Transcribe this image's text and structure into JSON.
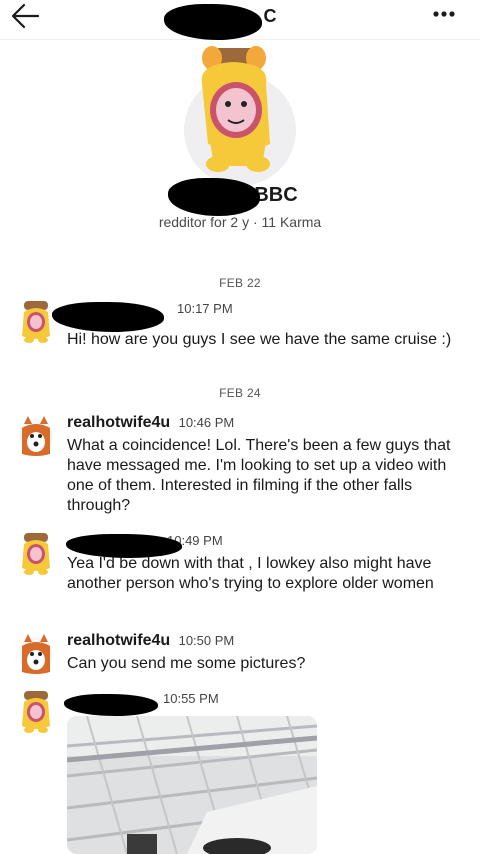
{
  "header": {
    "title_visible": "C",
    "back_icon": "arrow-left-icon",
    "more_icon": "more-horizontal-icon"
  },
  "profile": {
    "name_visible": "BBC",
    "meta": "redditor for 2 y · 11 Karma"
  },
  "dates": [
    "FEB 22",
    "FEB 24"
  ],
  "messages": [
    {
      "user": "",
      "time": "10:17 PM",
      "text": "Hi! how are you guys I see we have the same cruise :)"
    },
    {
      "user": "realhotwife4u",
      "time": "10:46 PM",
      "text": "What a coincidence! Lol. There's been a few guys that have messaged me. I'm looking to set up a video with one of them. Interested in filming if the other falls through?"
    },
    {
      "user": "",
      "time": "10:49 PM",
      "text": "Yea I'd be down with that , I lowkey also might have another person who's trying to explore older women"
    },
    {
      "user": "realhotwife4u",
      "time": "10:50 PM",
      "text": "Can you send me some pictures?"
    },
    {
      "user": "",
      "time": "10:55 PM",
      "text": ""
    }
  ],
  "colors": {
    "avatar_bg": "#efeff1",
    "dog_yellow": "#f5c93a",
    "fox_orange": "#d86a2a"
  }
}
